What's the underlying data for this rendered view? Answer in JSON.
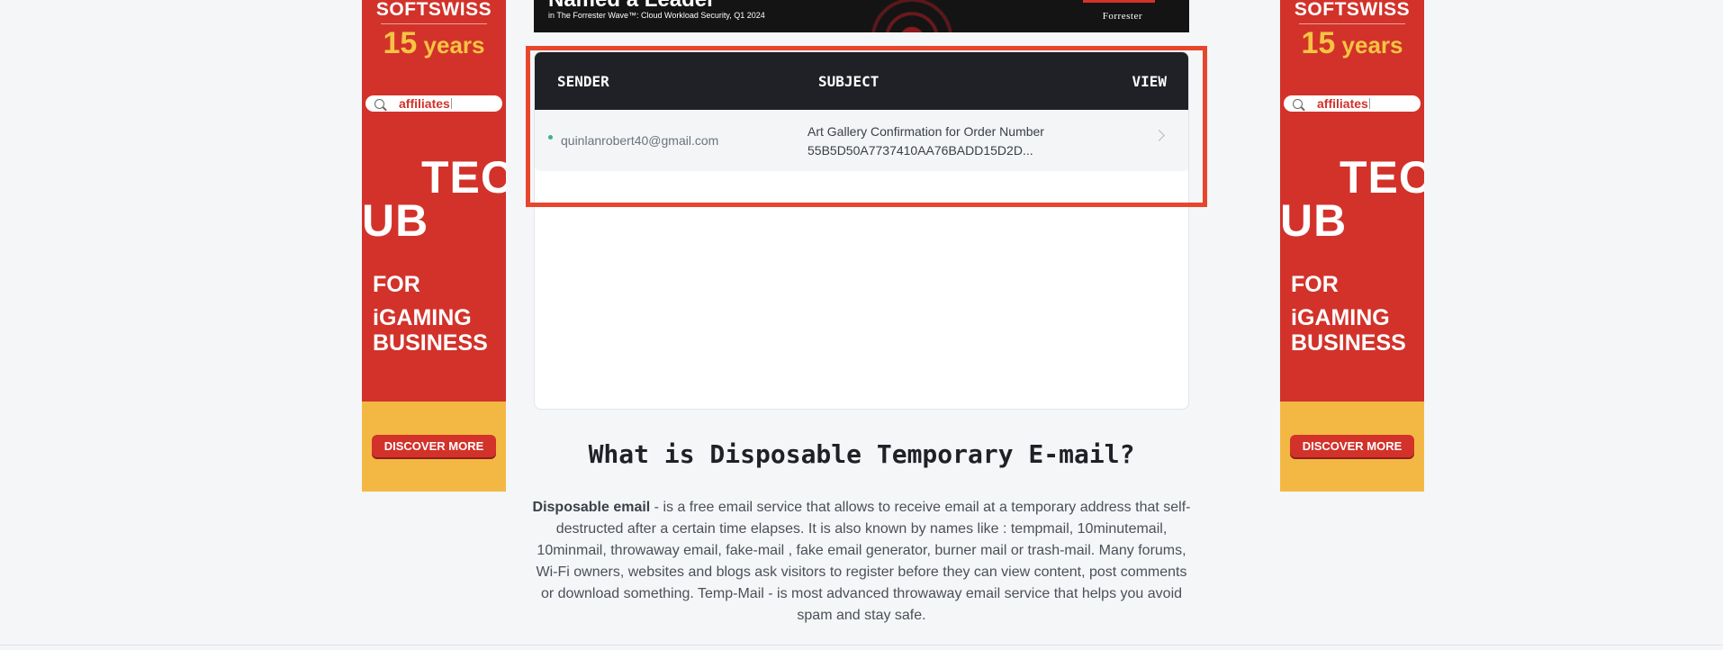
{
  "ads": {
    "brand": "SOFTSWISS",
    "years_num": "15",
    "years_word": "years",
    "search_query": "affiliates",
    "big_line1": "TEC",
    "big_line2": "UB",
    "for_line1": "FOR",
    "for_line2": "iGAMING",
    "for_line3": "BUSINESS",
    "cta": "DISCOVER MORE"
  },
  "banner": {
    "headline": "Named a Leader",
    "sub": "in The Forrester Wave™: Cloud Workload Security, Q1 2024",
    "logo": "Forrester"
  },
  "inbox": {
    "headers": {
      "sender": "SENDER",
      "subject": "SUBJECT",
      "view": "VIEW"
    },
    "messages": [
      {
        "sender": "quinlanrobert40@gmail.com",
        "subject": "Art Gallery Confirmation for Order Number 55B5D50A7737410AA76BADD15D2D...",
        "unread": true
      }
    ]
  },
  "faq": {
    "title": "What is Disposable Temporary E-mail?",
    "lead": "Disposable email",
    "body": " - is a free email service that allows to receive email at a temporary address that self-destructed after a certain time elapses. It is also known by names like : tempmail, 10minutemail, 10minmail, throwaway email, fake-mail , fake email generator, burner mail or trash-mail. Many forums, Wi-Fi owners, websites and blogs ask visitors to register before they can view content, post comments or download something. Temp-Mail - is most advanced throwaway email service that helps you avoid spam and stay safe."
  },
  "colors": {
    "ad_red": "#d2322a",
    "ad_yellow": "#f3b844",
    "header_dark": "#1f2127",
    "highlight": "#e8462c",
    "unread_dot": "#3ab48e"
  }
}
